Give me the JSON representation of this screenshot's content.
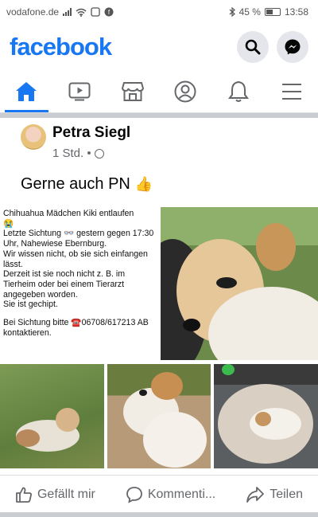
{
  "status": {
    "carrier": "vodafone.de",
    "battery": "45 %",
    "time": "13:58"
  },
  "header": {
    "logo": "facebook"
  },
  "nav": [
    "home-icon",
    "watch-icon",
    "marketplace-icon",
    "profile-icon",
    "notifications-icon",
    "menu-icon"
  ],
  "post": {
    "author": "Petra Siegl",
    "time": "1 Std. •",
    "text": "Gerne auch PN",
    "image_text": {
      "l1": "Chihuahua Mädchen Kiki entlaufen",
      "l2": "😭",
      "l3": "Letzte Sichtung 👓 gestern gegen 17:30 Uhr, Nahewiese Ebernburg.",
      "l4": "Wir wissen nicht, ob sie sich einfangen lässt.",
      "l5": "Derzeit ist sie noch nicht z. B. im Tierheim oder bei einem Tierarzt angegeben worden.",
      "l6": "Sie ist gechipt.",
      "l7": "Bei Sichtung bitte ☎️06708/617213 AB kontaktieren."
    },
    "actions": {
      "like": "Gefällt mir",
      "comment": "Kommenti...",
      "share": "Teilen"
    }
  },
  "colors": {
    "brand": "#1877f2",
    "secondary_text": "#65676b"
  }
}
